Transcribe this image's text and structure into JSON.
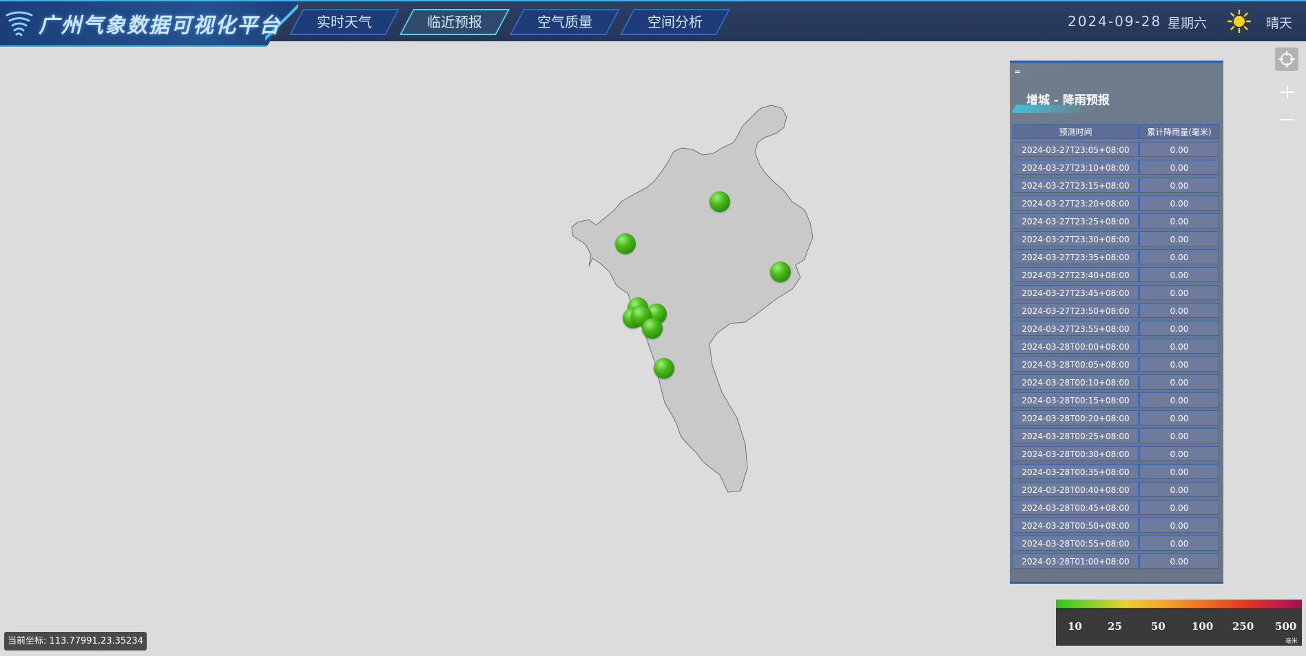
{
  "header": {
    "app_title": "广州气象数据可视化平台",
    "tabs": [
      {
        "label": "实时天气",
        "active": false
      },
      {
        "label": "临近预报",
        "active": true
      },
      {
        "label": "空气质量",
        "active": false
      },
      {
        "label": "空间分析",
        "active": false
      }
    ],
    "date": "2024-09-28",
    "weekday": "星期六",
    "weather_icon": "sun-icon",
    "weather": "晴天"
  },
  "colors": {
    "header_bg": "#2d3f63",
    "accent": "#3fb6e6",
    "station_green": "#4cbb1c",
    "map_fill": "#c9c9c9"
  },
  "map": {
    "region_icon": "guangzhou-region-shape",
    "station_marker_count": 10
  },
  "panel": {
    "grip": "=",
    "title": "增城 - 降雨预报",
    "columns": [
      "预测时间",
      "累计降雨量(毫米)"
    ],
    "rows": [
      {
        "time": "2024-03-27T23:05+08:00",
        "rain": "0.00"
      },
      {
        "time": "2024-03-27T23:10+08:00",
        "rain": "0.00"
      },
      {
        "time": "2024-03-27T23:15+08:00",
        "rain": "0.00"
      },
      {
        "time": "2024-03-27T23:20+08:00",
        "rain": "0.00"
      },
      {
        "time": "2024-03-27T23:25+08:00",
        "rain": "0.00"
      },
      {
        "time": "2024-03-27T23:30+08:00",
        "rain": "0.00"
      },
      {
        "time": "2024-03-27T23:35+08:00",
        "rain": "0.00"
      },
      {
        "time": "2024-03-27T23:40+08:00",
        "rain": "0.00"
      },
      {
        "time": "2024-03-27T23:45+08:00",
        "rain": "0.00"
      },
      {
        "time": "2024-03-27T23:50+08:00",
        "rain": "0.00"
      },
      {
        "time": "2024-03-27T23:55+08:00",
        "rain": "0.00"
      },
      {
        "time": "2024-03-28T00:00+08:00",
        "rain": "0.00"
      },
      {
        "time": "2024-03-28T00:05+08:00",
        "rain": "0.00"
      },
      {
        "time": "2024-03-28T00:10+08:00",
        "rain": "0.00"
      },
      {
        "time": "2024-03-28T00:15+08:00",
        "rain": "0.00"
      },
      {
        "time": "2024-03-28T00:20+08:00",
        "rain": "0.00"
      },
      {
        "time": "2024-03-28T00:25+08:00",
        "rain": "0.00"
      },
      {
        "time": "2024-03-28T00:30+08:00",
        "rain": "0.00"
      },
      {
        "time": "2024-03-28T00:35+08:00",
        "rain": "0.00"
      },
      {
        "time": "2024-03-28T00:40+08:00",
        "rain": "0.00"
      },
      {
        "time": "2024-03-28T00:45+08:00",
        "rain": "0.00"
      },
      {
        "time": "2024-03-28T00:50+08:00",
        "rain": "0.00"
      },
      {
        "time": "2024-03-28T00:55+08:00",
        "rain": "0.00"
      },
      {
        "time": "2024-03-28T01:00+08:00",
        "rain": "0.00"
      }
    ]
  },
  "legend": {
    "labels": [
      "10",
      "25",
      "50",
      "100",
      "250",
      "500"
    ],
    "unit": "毫米"
  },
  "coords": {
    "text": "当前坐标: 113.77991,23.35234"
  }
}
